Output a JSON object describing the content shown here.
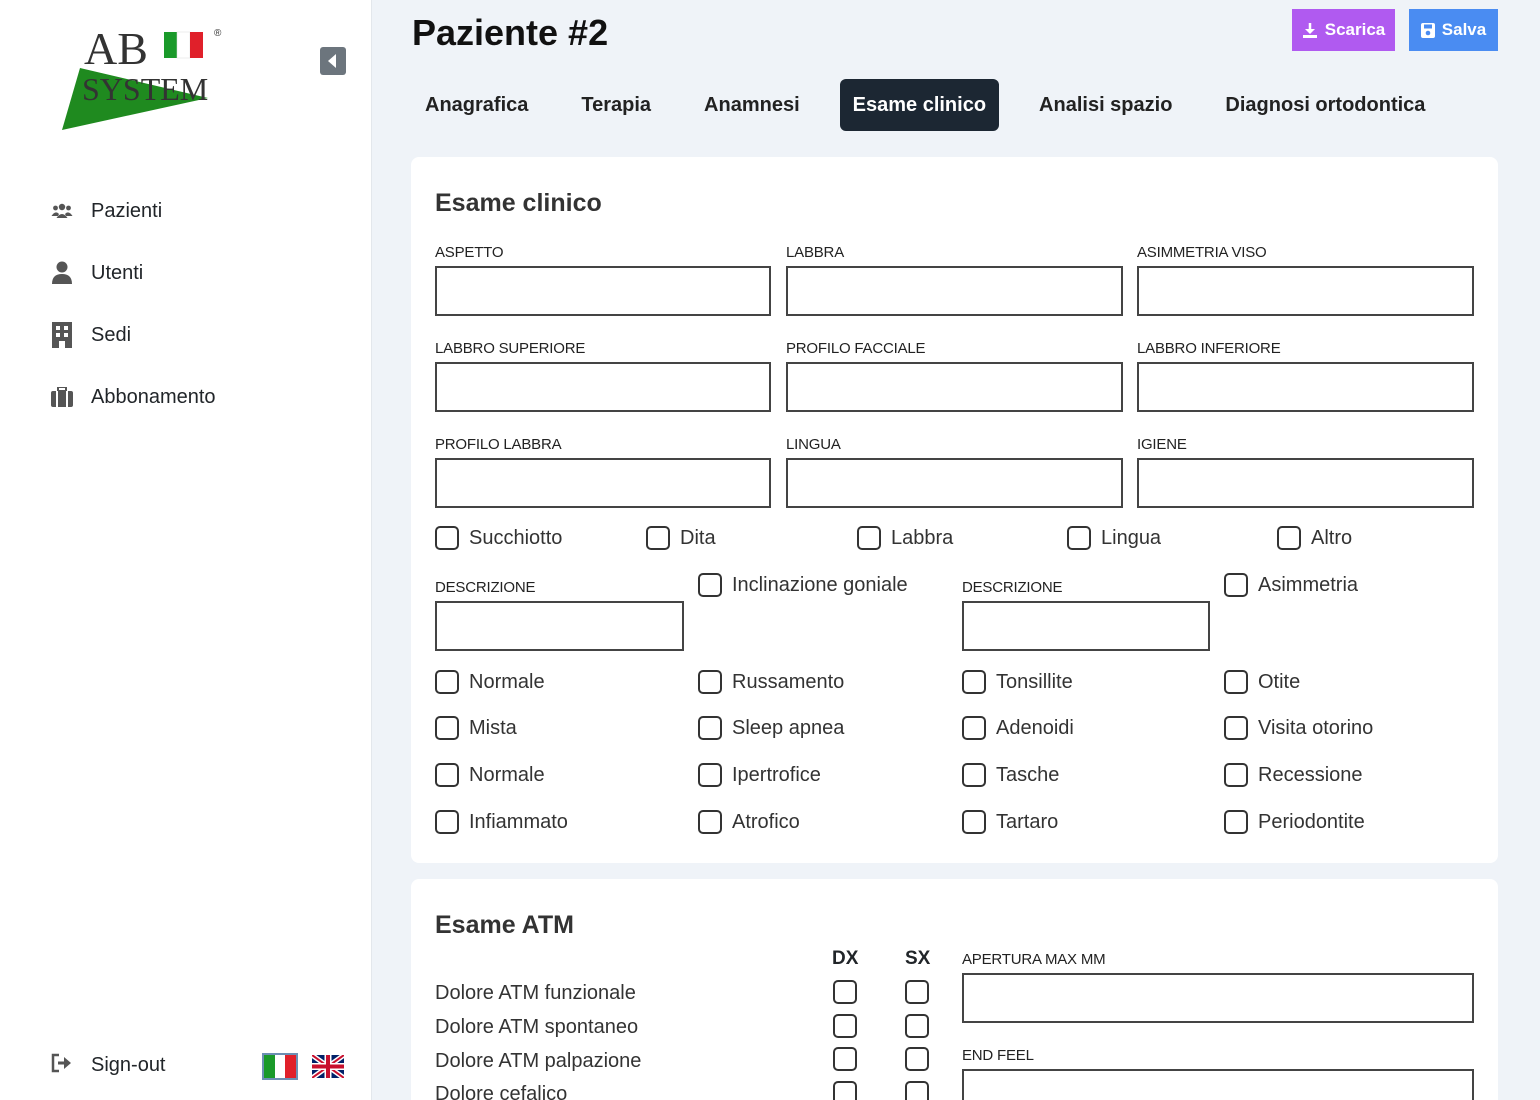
{
  "sidebar": {
    "brand_top": "AB",
    "brand_bottom": "SYSTEM",
    "brand_mark": "®",
    "items": [
      {
        "label": "Pazienti",
        "icon": "users-icon"
      },
      {
        "label": "Utenti",
        "icon": "user-icon"
      },
      {
        "label": "Sedi",
        "icon": "building-icon"
      },
      {
        "label": "Abbonamento",
        "icon": "briefcase-icon"
      }
    ],
    "signout": "Sign-out"
  },
  "header": {
    "title": "Paziente #2",
    "download_label": "Scarica",
    "save_label": "Salva"
  },
  "tabs": [
    "Anagrafica",
    "Terapia",
    "Anamnesi",
    "Esame clinico",
    "Analisi spazio",
    "Diagnosi ortodontica"
  ],
  "exam": {
    "title": "Esame clinico",
    "fields": [
      "Aspetto",
      "Labbra",
      "Asimmetria viso",
      "Labbro superiore",
      "Profilo facciale",
      "Labbro inferiore",
      "Profilo labbra",
      "Lingua",
      "Igiene"
    ],
    "habits": [
      "Succhiotto",
      "Dita",
      "Labbra",
      "Lingua",
      "Altro"
    ],
    "desc1": "Descrizione",
    "inclinazione": "Inclinazione goniale",
    "desc2": "Descrizione",
    "asimmetria": "Asimmetria",
    "grid": [
      [
        "Normale",
        "Russamento",
        "Tonsillite",
        "Otite"
      ],
      [
        "Mista",
        "Sleep apnea",
        "Adenoidi",
        "Visita otorino"
      ],
      [
        "Normale",
        "Ipertrofice",
        "Tasche",
        "Recessione"
      ],
      [
        "Infiammato",
        "Atrofico",
        "Tartaro",
        "Periodontite"
      ]
    ]
  },
  "atm": {
    "title": "Esame ATM",
    "dx": "DX",
    "sx": "SX",
    "rows": [
      "Dolore ATM funzionale",
      "Dolore ATM spontaneo",
      "Dolore ATM palpazione",
      "Dolore cefalico"
    ],
    "apertura": "Apertura max mm",
    "end_feel": "End feel"
  }
}
